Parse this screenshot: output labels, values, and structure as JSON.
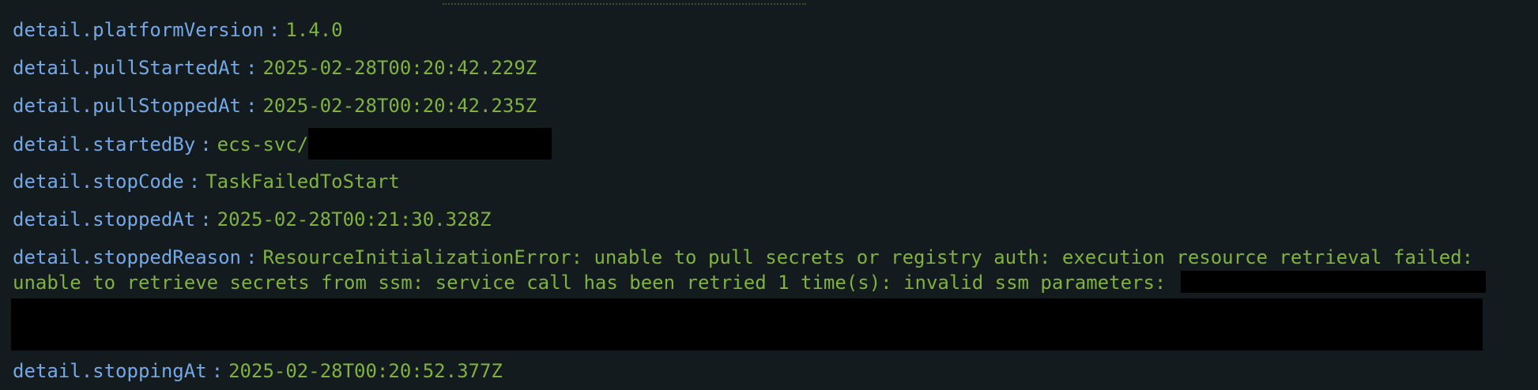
{
  "rows": {
    "platformVersion": {
      "key": "detail.platformVersion",
      "sep": ":",
      "value": "1.4.0"
    },
    "pullStartedAt": {
      "key": "detail.pullStartedAt",
      "sep": ":",
      "value": "2025-02-28T00:20:42.229Z"
    },
    "pullStoppedAt": {
      "key": "detail.pullStoppedAt",
      "sep": ":",
      "value": "2025-02-28T00:20:42.235Z"
    },
    "startedBy": {
      "key": "detail.startedBy",
      "sep": ":",
      "value": "ecs-svc/"
    },
    "stopCode": {
      "key": "detail.stopCode",
      "sep": ":",
      "value": "TaskFailedToStart"
    },
    "stoppedAt": {
      "key": "detail.stoppedAt",
      "sep": ":",
      "value": "2025-02-28T00:21:30.328Z"
    },
    "stoppedReason": {
      "key": "detail.stoppedReason",
      "sep": ":",
      "value_line1": "ResourceInitializationError: unable to pull secrets or registry auth: execution resource retrieval failed:",
      "value_line2": "unable to retrieve secrets from ssm: service call has been retried 1 time(s): invalid ssm parameters:"
    },
    "stoppingAt": {
      "key": "detail.stoppingAt",
      "sep": ":",
      "value": "2025-02-28T00:20:52.377Z"
    }
  },
  "colors": {
    "background": "#131b1f",
    "key": "#75a8e6",
    "value": "#7fb23e",
    "redaction": "#000000"
  }
}
